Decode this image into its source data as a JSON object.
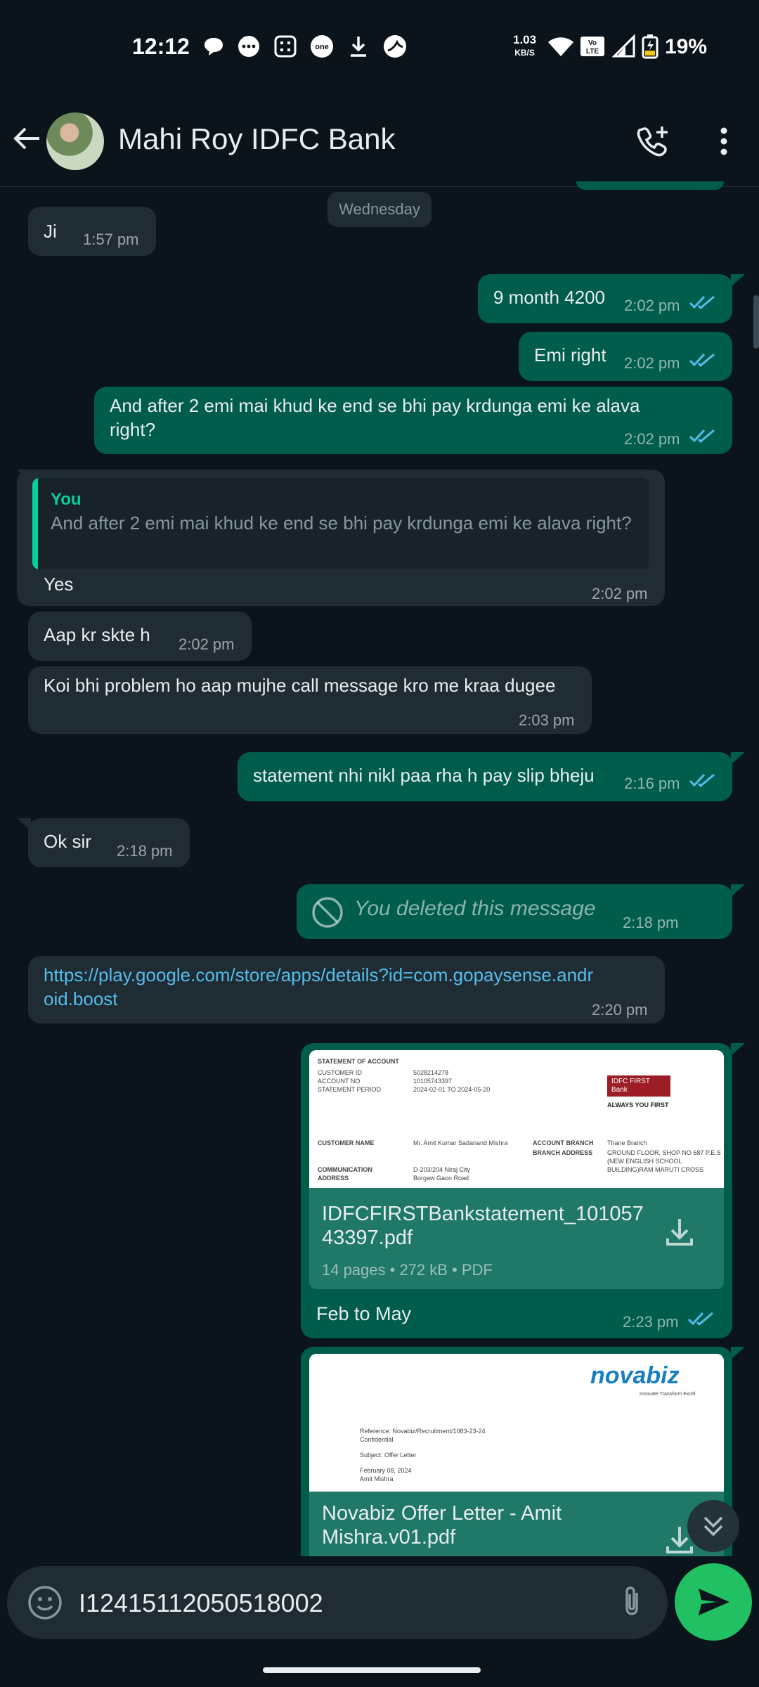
{
  "status_bar": {
    "time": "12:12",
    "net_speed_value": "1.03",
    "net_speed_unit": "KB/S",
    "volte": "Vo LTE",
    "battery": "19%"
  },
  "header": {
    "contact_name": "Mahi Roy IDFC Bank"
  },
  "date_chip": "Wednesday",
  "messages": [
    {
      "dir": "in",
      "text": "Ji",
      "time": "1:57 pm"
    },
    {
      "dir": "out",
      "text": "9 month 4200",
      "time": "2:02 pm"
    },
    {
      "dir": "out",
      "text": "Emi right",
      "time": "2:02 pm"
    },
    {
      "dir": "out",
      "text": "And after 2 emi mai khud ke end se bhi pay krdunga emi ke alava right?",
      "time": "2:02 pm"
    },
    {
      "dir": "in",
      "quote_author": "You",
      "quote_text": "And after 2 emi mai khud ke end se bhi pay krdunga emi ke alava right?",
      "text": "Yes",
      "time": "2:02 pm"
    },
    {
      "dir": "in",
      "text": "Aap kr skte h",
      "time": "2:02 pm"
    },
    {
      "dir": "in",
      "text": "Koi bhi problem ho aap mujhe call message kro me kraa dugee",
      "time": "2:03 pm"
    },
    {
      "dir": "out",
      "text": "statement nhi nikl paa rha h pay slip bheju",
      "time": "2:16 pm"
    },
    {
      "dir": "in",
      "text": "Ok sir",
      "time": "2:18 pm"
    },
    {
      "dir": "out",
      "text": "You deleted this message",
      "time": "2:18 pm"
    },
    {
      "dir": "in",
      "text": "https://play.google.com/store/apps/details?id=com.gopaysense.android.boost",
      "time": "2:20 pm"
    },
    {
      "dir": "out",
      "doc_name": "IDFCFIRSTBankstatement_10105743397.pdf",
      "doc_meta": "14 pages • 272 kB • PDF",
      "caption": "Feb to May",
      "time": "2:23 pm"
    },
    {
      "dir": "out",
      "doc_name": "Novabiz Offer Letter - Amit Mishra.v01.pdf"
    }
  ],
  "doc1_preview": {
    "heading": "STATEMENT OF ACCOUNT",
    "rows": [
      "CUSTOMER ID",
      "ACCOUNT NO",
      "STATEMENT PERIOD"
    ],
    "vals": [
      "5028214278",
      "10105743397",
      "2024-02-01 TO 2024-05-20"
    ],
    "bank": "IDFC FIRST Bank",
    "tagline": "ALWAYS YOU FIRST",
    "cust_label": "CUSTOMER NAME",
    "cust_val": "Mr. Amit Kumar Sadanand Mishra",
    "comm_label": "COMMUNICATION ADDRESS",
    "comm_val": "D-203/204 Niraj City Borgaw Gaon Road",
    "branch_label": "ACCOUNT BRANCH",
    "branch_val": "Thane Branch",
    "baddr_label": "BRANCH ADDRESS",
    "baddr_val": "GROUND FLOOR, SHOP NO 687 P.E.S (NEW ENGLISH SCHOOL BUILDING)RAM MARUTI CROSS"
  },
  "doc2_preview": {
    "logo": "novabiz",
    "tagline": "Innovate Transform Excel",
    "ref": "Reference: Novabiz/Recruitment/1083-23-24",
    "conf": "Confidential",
    "subject": "Subject: Offer Letter",
    "date": "February 08, 2024",
    "name": "Amit Mishra"
  },
  "composer": {
    "value": "I12415112050518002"
  },
  "colors": {
    "background": "#0b141a",
    "incoming": "#202c33",
    "outgoing": "#005c4b",
    "accent": "#21c063",
    "read_ticks": "#53bdeb"
  }
}
